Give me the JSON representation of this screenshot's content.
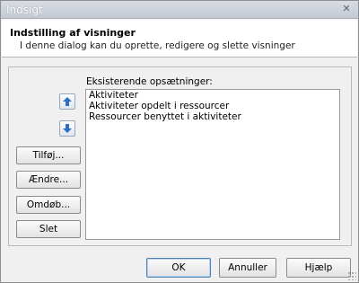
{
  "window": {
    "title": "Indsigt"
  },
  "header": {
    "title": "Indstilling af visninger",
    "subtitle": "I denne dialog kan du oprette, redigere og slette visninger"
  },
  "list": {
    "label": "Eksisterende opsætninger:",
    "items": [
      "Aktiviteter",
      "Aktiviteter opdelt i ressourcer",
      "Ressourcer benyttet i aktiviteter"
    ]
  },
  "buttons": {
    "add": "Tilføj...",
    "change": "Ændre...",
    "rename": "Omdøb...",
    "delete": "Slet",
    "ok": "OK",
    "cancel": "Annuller",
    "help": "Hjælp"
  },
  "icons": {
    "close": "close-icon",
    "move_up": "arrow-up-icon",
    "move_down": "arrow-down-icon"
  },
  "colors": {
    "accent": "#2e6fc4"
  }
}
